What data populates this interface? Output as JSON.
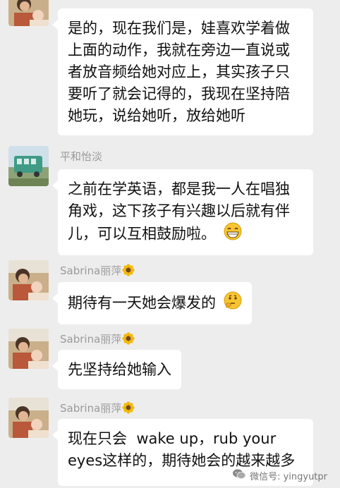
{
  "messages": [
    {
      "lines": [
        "是的，现在我们是，娃喜欢学着做",
        "上面的动作，我就在旁边一直说或",
        "者放音频给她对应上，其实孩子只",
        "要听了就会记得的，我现在坚持陪",
        "她玩，说给她听，放给她听"
      ]
    },
    {
      "sender": "平和怡淡",
      "lines": [
        "之前在学英语，都是我一人在唱独",
        "角戏，这下孩子有兴趣以后就有伴",
        "儿，可以互相鼓励啦。"
      ],
      "emoji": "grin-emoji"
    },
    {
      "sender": "Sabrina丽萍",
      "sender_emoji": "sunflower-emoji",
      "lines": [
        "期待有一天她会爆发的"
      ],
      "emoji": "thinking-emoji"
    },
    {
      "sender": "Sabrina丽萍",
      "sender_emoji": "sunflower-emoji",
      "lines": [
        "先坚持给她输入"
      ]
    },
    {
      "sender": "Sabrina丽萍",
      "sender_emoji": "sunflower-emoji",
      "lines": [
        "现在只会  wake up，rub your",
        "eyes这样的，期待她会的越来越多"
      ]
    }
  ],
  "watermark": {
    "text": "微信号: yingyutpr",
    "icon": "wechat-icon"
  },
  "colors": {
    "background": "#ededed",
    "bubble": "#ffffff",
    "sender": "#9a9a9a"
  }
}
